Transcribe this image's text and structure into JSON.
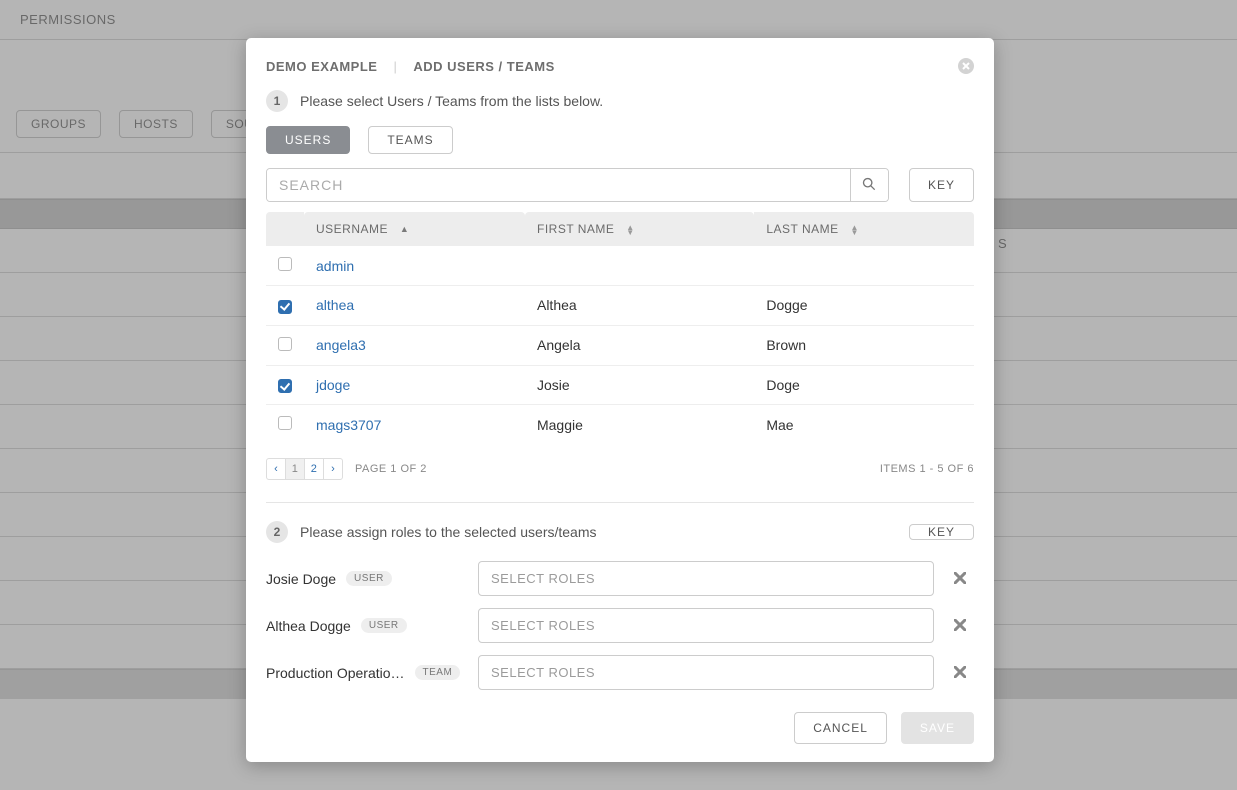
{
  "background": {
    "title": "PERMISSIONS",
    "tabs": [
      "GROUPS",
      "HOSTS",
      "SOUR"
    ],
    "peek_column": "S"
  },
  "modal": {
    "breadcrumb": {
      "item1": "DEMO  EXAMPLE",
      "item2": "ADD USERS / TEAMS"
    },
    "step1": {
      "number": "1",
      "text": "Please select Users / Teams from the lists below."
    },
    "type_toggle": {
      "users": "USERS",
      "teams": "TEAMS",
      "active": "users"
    },
    "search": {
      "placeholder": "SEARCH"
    },
    "key_button": "KEY",
    "table": {
      "columns": {
        "username": "USERNAME",
        "first_name": "FIRST NAME",
        "last_name": "LAST NAME"
      },
      "rows": [
        {
          "checked": false,
          "username": "admin",
          "first": "",
          "last": ""
        },
        {
          "checked": true,
          "username": "althea",
          "first": "Althea",
          "last": "Dogge"
        },
        {
          "checked": false,
          "username": "angela3",
          "first": "Angela",
          "last": "Brown"
        },
        {
          "checked": true,
          "username": "jdoge",
          "first": "Josie",
          "last": "Doge"
        },
        {
          "checked": false,
          "username": "mags3707",
          "first": "Maggie",
          "last": "Mae"
        }
      ]
    },
    "pagination": {
      "pages": [
        "1",
        "2"
      ],
      "active_page": "1",
      "page_label": "PAGE 1 OF 2",
      "items_label": "ITEMS  1 - 5 OF 6"
    },
    "step2": {
      "number": "2",
      "text": "Please assign roles to the selected users/teams",
      "key_button": "KEY"
    },
    "assignments": [
      {
        "name": "Josie Doge",
        "tag": "USER",
        "placeholder": "SELECT ROLES"
      },
      {
        "name": "Althea Dogge",
        "tag": "USER",
        "placeholder": "SELECT ROLES"
      },
      {
        "name": "Production Operatio…",
        "tag": "TEAM",
        "placeholder": "SELECT ROLES"
      }
    ],
    "footer": {
      "cancel": "CANCEL",
      "save": "SAVE"
    }
  }
}
